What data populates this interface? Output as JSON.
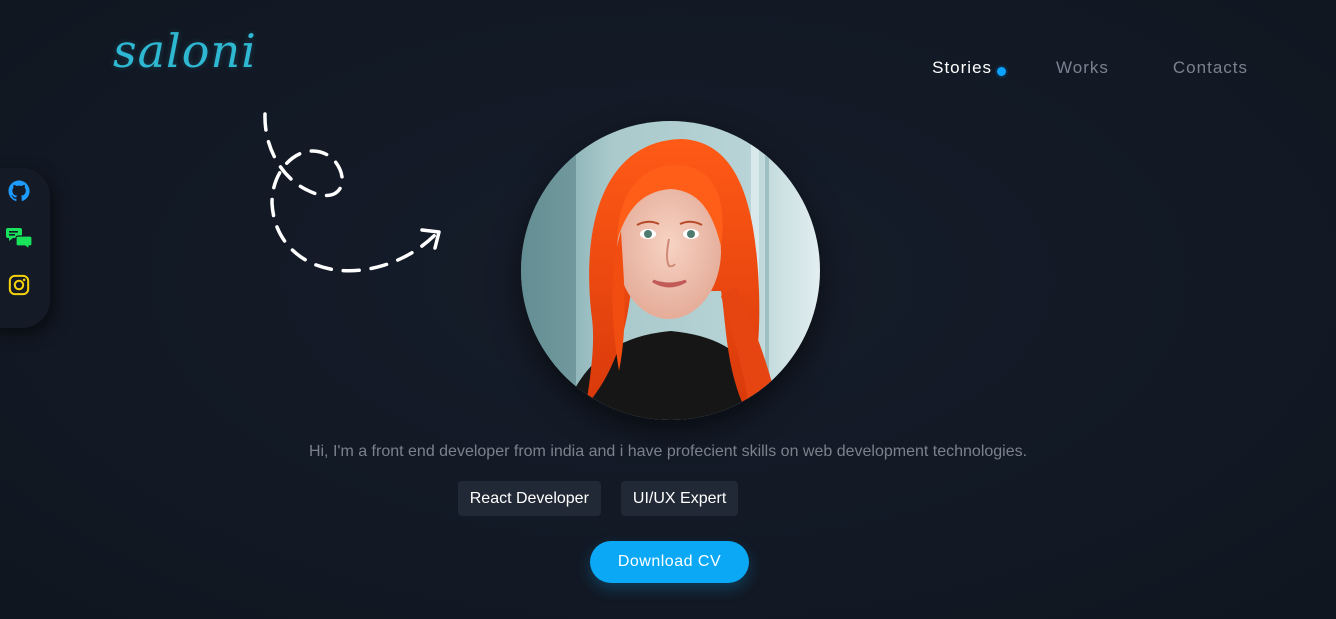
{
  "header": {
    "logo_text": "saloni",
    "nav": [
      {
        "label": "Stories",
        "active": true
      },
      {
        "label": "Works",
        "active": false
      },
      {
        "label": "Contacts",
        "active": false
      }
    ]
  },
  "social": [
    {
      "icon": "github-icon",
      "color": "#1e9bff"
    },
    {
      "icon": "messages-icon",
      "color": "#19e35a"
    },
    {
      "icon": "instagram-icon",
      "color": "#f5d20a"
    }
  ],
  "hero": {
    "intro": "Hi, I'm a front end developer from india and i have profecient skills on web development technologies.",
    "tags": [
      "React Developer",
      "UI/UX Expert"
    ],
    "cta_label": "Download CV"
  },
  "colors": {
    "background": "#131a26",
    "accent": "#0aa8f5",
    "logo": "#2fb8d2"
  }
}
